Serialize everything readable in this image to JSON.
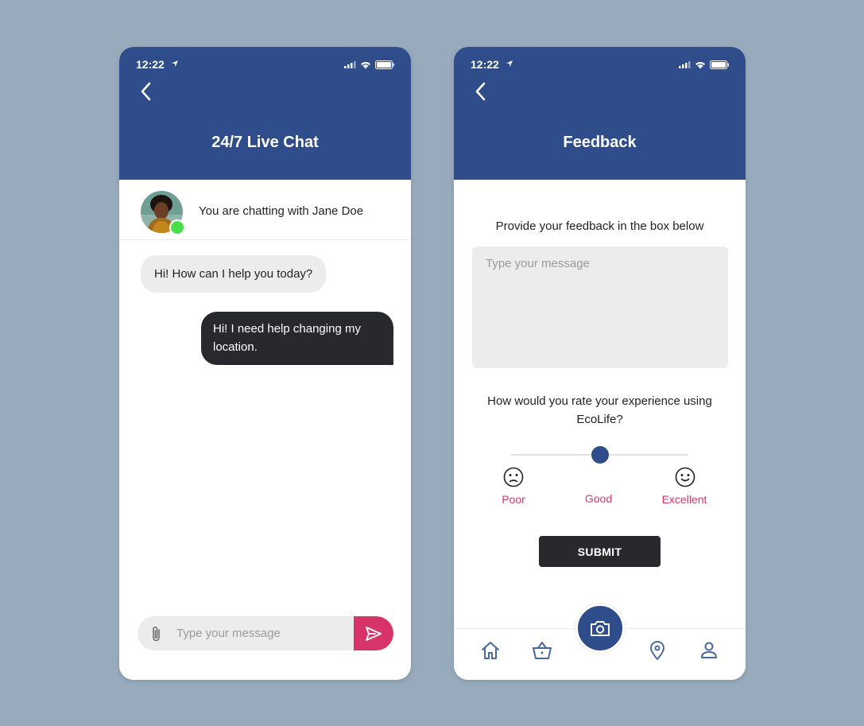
{
  "status_bar": {
    "time": "12:22"
  },
  "chat_screen": {
    "title": "24/7 Live Chat",
    "chatting_with": "You are chatting with Jane Doe",
    "messages": [
      {
        "from": "agent",
        "text": "Hi! How can I help you today?"
      },
      {
        "from": "user",
        "text": "Hi! I need help changing my location."
      }
    ],
    "input_placeholder": "Type your message"
  },
  "feedback_screen": {
    "title": "Feedback",
    "prompt": "Provide your feedback in the box below",
    "textarea_placeholder": "Type your message",
    "rating_question": "How would you rate your experience using EcoLife?",
    "rating_labels": [
      "Poor",
      "Good",
      "Excellent"
    ],
    "selected_rating": "Good",
    "submit_label": "SUBMIT",
    "nav_items": [
      "home-icon",
      "basket-icon",
      "camera-icon",
      "location-pin-icon",
      "profile-icon"
    ]
  },
  "colors": {
    "background": "#97abbd",
    "header": "#2f4d8a",
    "accent_pink": "#d7356a",
    "dark": "#28292d",
    "online": "#47e04a"
  }
}
